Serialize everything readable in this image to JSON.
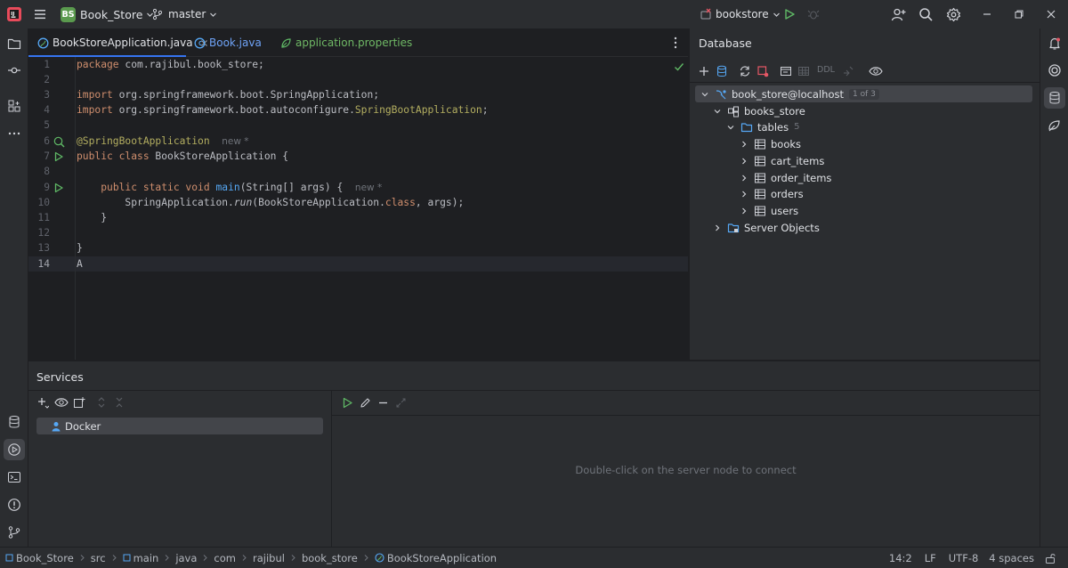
{
  "titlebar": {
    "project_badge": "BS",
    "project_name": "Book_Store",
    "branch": "master",
    "run_config": "bookstore"
  },
  "tabs": [
    {
      "label": "BookStoreApplication.java",
      "active": true
    },
    {
      "label": "Book.java",
      "active": false
    },
    {
      "label": "application.properties",
      "active": false
    }
  ],
  "editor": {
    "line_numbers": [
      "1",
      "2",
      "3",
      "4",
      "5",
      "6",
      "7",
      "8",
      "9",
      "10",
      "11",
      "12",
      "13",
      "14"
    ],
    "l1_kw": "package",
    "l1_rest": " com.rajibul.book_store;",
    "l3_kw": "import",
    "l3_rest": " org.springframework.boot.SpringApplication;",
    "l4_kw": "import",
    "l4_rest": " org.springframework.boot.autoconfigure.",
    "l4_ann": "SpringBootApplication",
    "l4_end": ";",
    "l6_ann": "@SpringBootApplication",
    "l6_hint": "new *",
    "l7_kw": "public class",
    "l7_rest": " BookStoreApplication {",
    "l9_kw": "public static void",
    "l9_fn": "main",
    "l9_rest": "(String[] args) {",
    "l9_hint": "new *",
    "l10_pre": "SpringApplication.",
    "l10_run": "run",
    "l10_mid": "(BookStoreApplication.",
    "l10_kw": "class",
    "l10_end": ", args);",
    "l11": "}",
    "l13": "}",
    "l14": "A"
  },
  "database": {
    "title": "Database",
    "ddl_label": "DDL",
    "datasource": "book_store@localhost",
    "datasource_badge": "1 of 3",
    "schema": "books_store",
    "tables_label": "tables",
    "tables_count": "5",
    "tables": [
      "books",
      "cart_items",
      "order_items",
      "orders",
      "users"
    ],
    "server_objects": "Server Objects"
  },
  "services": {
    "title": "Services",
    "docker_label": "Docker",
    "empty_message": "Double-click on the server node to connect"
  },
  "statusbar": {
    "breadcrumbs": [
      "Book_Store",
      "src",
      "main",
      "java",
      "com",
      "rajibul",
      "book_store",
      "BookStoreApplication"
    ],
    "position": "14:2",
    "line_ending": "LF",
    "encoding": "UTF-8",
    "indent": "4 spaces"
  },
  "colors": {
    "accent": "#3574f0",
    "run_green": "#5fb865",
    "badge_green": "#5a9a4e"
  }
}
